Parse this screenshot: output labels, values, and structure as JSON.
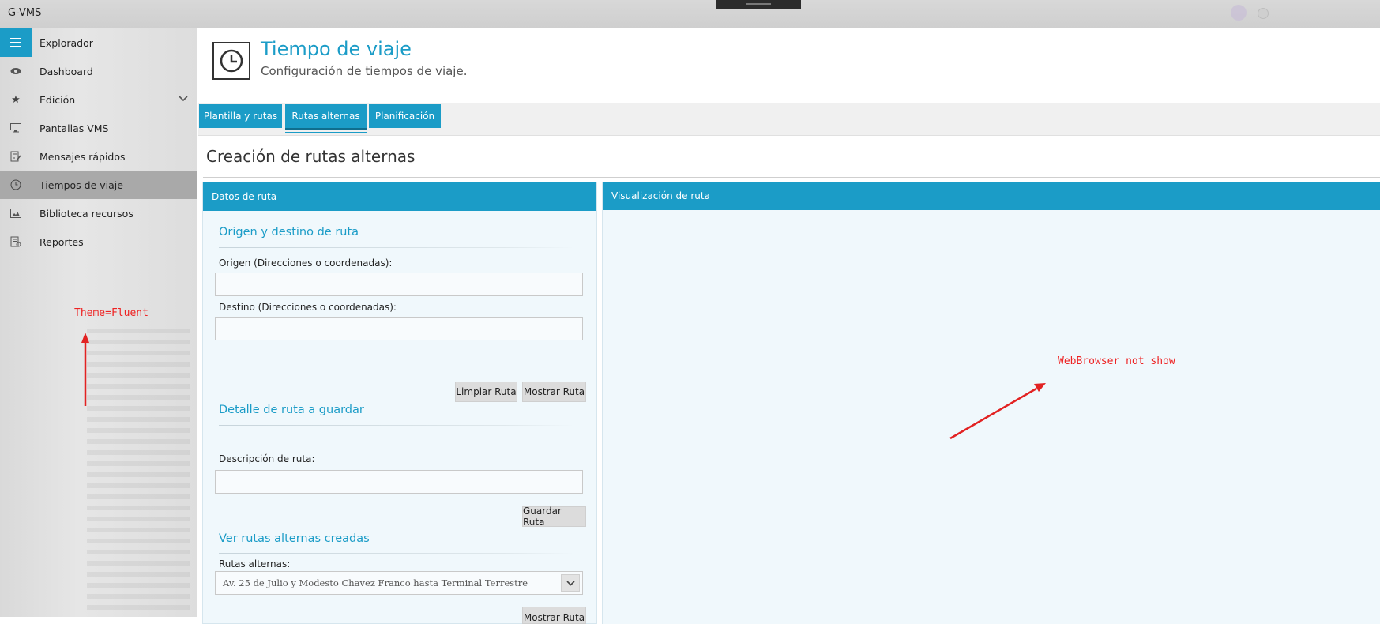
{
  "window": {
    "title": "G-VMS"
  },
  "sidebar": {
    "items": [
      {
        "label": "Explorador",
        "icon": "hamburger-icon"
      },
      {
        "label": "Dashboard",
        "icon": "eye-icon"
      },
      {
        "label": "Edición",
        "icon": "star-icon",
        "expandable": true
      },
      {
        "label": "Pantallas VMS",
        "icon": "monitor-icon"
      },
      {
        "label": "Mensajes rápidos",
        "icon": "edit-doc-icon"
      },
      {
        "label": "Tiempos de viaje",
        "icon": "clock-icon",
        "active": true
      },
      {
        "label": "Biblioteca recursos",
        "icon": "image-icon"
      },
      {
        "label": "Reportes",
        "icon": "report-icon"
      }
    ]
  },
  "header": {
    "title": "Tiempo de viaje",
    "subtitle": "Configuración de tiempos de viaje."
  },
  "tabs": [
    {
      "label": "Plantilla y rutas"
    },
    {
      "label": "Rutas alternas",
      "active": true
    },
    {
      "label": "Planificación"
    }
  ],
  "section": {
    "title": "Creación de rutas alternas"
  },
  "left_panel": {
    "header": "Datos de ruta",
    "origin_dest": {
      "title": "Origen y destino de ruta",
      "origin_label": "Origen (Direcciones o coordenadas):",
      "origin_value": "",
      "dest_label": "Destino (Direcciones o coordenadas):",
      "dest_value": "",
      "clear_button": "Limpiar Ruta",
      "show_button": "Mostrar Ruta"
    },
    "detail": {
      "title": "Detalle de ruta a guardar",
      "desc_label": "Descripción de ruta:",
      "desc_value": "",
      "save_button": "Guardar Ruta"
    },
    "alternates": {
      "title": "Ver rutas alternas creadas",
      "select_label": "Rutas alternas:",
      "selected": "Av. 25 de Julio y Modesto Chavez Franco hasta Terminal Terrestre",
      "show_button": "Mostrar Ruta"
    }
  },
  "right_panel": {
    "header": "Visualización de ruta"
  },
  "annotations": {
    "theme_note": "Theme=Fluent",
    "browser_note": "WebBrowser not show",
    "color": "#e22222"
  },
  "colors": {
    "accent": "#1b9cc7",
    "panel_bg": "#f0f8fc",
    "sidebar_active": "#a9a9a9"
  }
}
